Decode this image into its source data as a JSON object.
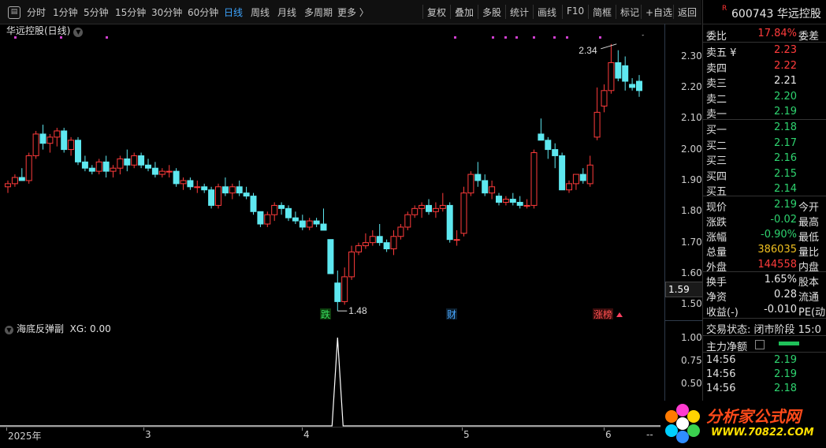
{
  "toolbar": {
    "periods": [
      "分时",
      "1分钟",
      "5分钟",
      "15分钟",
      "30分钟",
      "60分钟",
      "日线",
      "周线",
      "月线",
      "多周期",
      "更多 〉"
    ],
    "active_period": "日线",
    "actions": [
      "复权",
      "叠加",
      "多股",
      "统计",
      "画线",
      "F10",
      "简框",
      "标记",
      "+自选",
      "返回"
    ]
  },
  "chart": {
    "title": "华远控股(日线)",
    "y_ticks": [
      "2.30",
      "2.20",
      "2.10",
      "2.00",
      "1.90",
      "1.80",
      "1.70",
      "1.60",
      "1.50"
    ],
    "current_price_label": "1.59",
    "high_label": "2.34",
    "low_label": "1.48",
    "markers": [
      "跌",
      "财",
      "涨榜"
    ],
    "sub_title": "海底反弹副",
    "sub_indicator": "XG: 0.00",
    "sub_ticks": [
      "1.00",
      "0.75",
      "0.50",
      "0.25"
    ],
    "date_labels": [
      "2025年",
      "3",
      "4",
      "5",
      "6",
      "--"
    ]
  },
  "chart_data": [
    {
      "type": "candlestick",
      "title": "华远控股(日线)",
      "ylim": [
        1.45,
        2.37
      ],
      "up_color": "#ff3b3b",
      "down_color": "#5ee8f0",
      "candles": [
        [
          1.88,
          1.9,
          1.86,
          1.89
        ],
        [
          1.89,
          1.92,
          1.88,
          1.91
        ],
        [
          1.91,
          1.94,
          1.9,
          1.9
        ],
        [
          1.9,
          1.99,
          1.89,
          1.98
        ],
        [
          1.98,
          2.06,
          1.97,
          2.05
        ],
        [
          2.05,
          2.08,
          2.0,
          2.02
        ],
        [
          2.02,
          2.05,
          1.99,
          2.04
        ],
        [
          2.04,
          2.07,
          2.01,
          2.06
        ],
        [
          2.06,
          2.07,
          1.99,
          2.0
        ],
        [
          2.0,
          2.04,
          1.98,
          2.03
        ],
        [
          2.03,
          2.04,
          1.95,
          1.96
        ],
        [
          1.96,
          1.98,
          1.93,
          1.94
        ],
        [
          1.94,
          1.95,
          1.92,
          1.93
        ],
        [
          1.93,
          1.97,
          1.92,
          1.96
        ],
        [
          1.96,
          1.98,
          1.91,
          1.93
        ],
        [
          1.93,
          1.95,
          1.91,
          1.94
        ],
        [
          1.94,
          1.98,
          1.92,
          1.97
        ],
        [
          1.97,
          2.0,
          1.93,
          1.95
        ],
        [
          1.95,
          1.99,
          1.94,
          1.98
        ],
        [
          1.98,
          1.99,
          1.94,
          1.95
        ],
        [
          1.95,
          1.97,
          1.93,
          1.94
        ],
        [
          1.94,
          1.96,
          1.91,
          1.92
        ],
        [
          1.92,
          1.94,
          1.91,
          1.93
        ],
        [
          1.93,
          1.95,
          1.91,
          1.93
        ],
        [
          1.93,
          1.94,
          1.88,
          1.89
        ],
        [
          1.89,
          1.91,
          1.87,
          1.9
        ],
        [
          1.9,
          1.91,
          1.87,
          1.88
        ],
        [
          1.88,
          1.9,
          1.86,
          1.88
        ],
        [
          1.88,
          1.89,
          1.86,
          1.87
        ],
        [
          1.87,
          1.88,
          1.81,
          1.82
        ],
        [
          1.82,
          1.89,
          1.81,
          1.88
        ],
        [
          1.88,
          1.91,
          1.85,
          1.86
        ],
        [
          1.86,
          1.89,
          1.84,
          1.88
        ],
        [
          1.88,
          1.9,
          1.85,
          1.86
        ],
        [
          1.86,
          1.88,
          1.84,
          1.85
        ],
        [
          1.85,
          1.86,
          1.79,
          1.8
        ],
        [
          1.8,
          1.8,
          1.75,
          1.76
        ],
        [
          1.76,
          1.8,
          1.75,
          1.79
        ],
        [
          1.79,
          1.83,
          1.77,
          1.82
        ],
        [
          1.82,
          1.83,
          1.79,
          1.81
        ],
        [
          1.81,
          1.82,
          1.77,
          1.78
        ],
        [
          1.78,
          1.8,
          1.76,
          1.77
        ],
        [
          1.77,
          1.79,
          1.74,
          1.75
        ],
        [
          1.75,
          1.78,
          1.74,
          1.77
        ],
        [
          1.77,
          1.78,
          1.75,
          1.76
        ],
        [
          1.76,
          1.81,
          1.74,
          1.74
        ],
        [
          1.71,
          1.71,
          1.6,
          1.6
        ],
        [
          1.57,
          1.61,
          1.48,
          1.51
        ],
        [
          1.51,
          1.62,
          1.5,
          1.59
        ],
        [
          1.59,
          1.69,
          1.58,
          1.67
        ],
        [
          1.67,
          1.7,
          1.66,
          1.69
        ],
        [
          1.69,
          1.73,
          1.68,
          1.7
        ],
        [
          1.7,
          1.74,
          1.69,
          1.72
        ],
        [
          1.72,
          1.76,
          1.69,
          1.7
        ],
        [
          1.7,
          1.71,
          1.67,
          1.68
        ],
        [
          1.68,
          1.74,
          1.66,
          1.72
        ],
        [
          1.72,
          1.76,
          1.71,
          1.75
        ],
        [
          1.75,
          1.8,
          1.74,
          1.79
        ],
        [
          1.79,
          1.82,
          1.78,
          1.81
        ],
        [
          1.81,
          1.83,
          1.78,
          1.82
        ],
        [
          1.82,
          1.84,
          1.79,
          1.8
        ],
        [
          1.8,
          1.83,
          1.78,
          1.81
        ],
        [
          1.81,
          1.86,
          1.8,
          1.82
        ],
        [
          1.82,
          1.83,
          1.7,
          1.71
        ],
        [
          1.71,
          1.74,
          1.69,
          1.71
        ],
        [
          1.73,
          1.88,
          1.72,
          1.86
        ],
        [
          1.86,
          1.93,
          1.85,
          1.92
        ],
        [
          1.92,
          1.96,
          1.88,
          1.9
        ],
        [
          1.9,
          1.92,
          1.85,
          1.86
        ],
        [
          1.86,
          1.9,
          1.84,
          1.88
        ],
        [
          1.85,
          1.86,
          1.82,
          1.83
        ],
        [
          1.83,
          1.85,
          1.82,
          1.84
        ],
        [
          1.84,
          1.86,
          1.82,
          1.83
        ],
        [
          1.83,
          1.85,
          1.81,
          1.82
        ],
        [
          1.82,
          1.84,
          1.81,
          1.82
        ],
        [
          1.82,
          2.0,
          1.81,
          1.99
        ],
        [
          2.05,
          2.1,
          2.03,
          2.03
        ],
        [
          2.03,
          2.04,
          1.97,
          2.0
        ],
        [
          2.0,
          2.02,
          1.94,
          1.98
        ],
        [
          1.98,
          1.99,
          1.87,
          1.87
        ],
        [
          1.87,
          1.9,
          1.86,
          1.89
        ],
        [
          1.89,
          1.92,
          1.87,
          1.92
        ],
        [
          1.92,
          1.94,
          1.89,
          1.9
        ],
        [
          1.89,
          1.98,
          1.88,
          1.95
        ],
        [
          2.04,
          2.2,
          2.03,
          2.12
        ],
        [
          2.14,
          2.21,
          2.12,
          2.19
        ],
        [
          2.19,
          2.34,
          2.18,
          2.28
        ],
        [
          2.28,
          2.32,
          2.22,
          2.23
        ],
        [
          2.27,
          2.3,
          2.19,
          2.22
        ],
        [
          2.21,
          2.23,
          2.19,
          2.2
        ],
        [
          2.22,
          2.24,
          2.17,
          2.19
        ]
      ]
    },
    {
      "type": "line",
      "title": "海底反弹副",
      "ylim": [
        0,
        1
      ],
      "series": [
        {
          "name": "XG",
          "spike_index": 47,
          "values_note": "0 everywhere except 1.00 at spike_index"
        }
      ]
    }
  ],
  "side": {
    "stock_badge": "R",
    "stock_code": "600743 华远控股",
    "weibi_label": "委比",
    "weibi_value": "17.84%",
    "weicha_label": "委差",
    "asks": [
      {
        "label": "卖五 ¥",
        "price": "2.23"
      },
      {
        "label": "卖四",
        "price": "2.22"
      },
      {
        "label": "卖三",
        "price": "2.21"
      },
      {
        "label": "卖二",
        "price": "2.20"
      },
      {
        "label": "卖一",
        "price": "2.19"
      }
    ],
    "bids": [
      {
        "label": "买一",
        "price": "2.18"
      },
      {
        "label": "买二",
        "price": "2.17"
      },
      {
        "label": "买三",
        "price": "2.16"
      },
      {
        "label": "买四",
        "price": "2.15"
      },
      {
        "label": "买五",
        "price": "2.14"
      }
    ],
    "stats": [
      {
        "label": "现价",
        "value": "2.19",
        "right": "今开"
      },
      {
        "label": "涨跌",
        "value": "-0.02",
        "right": "最高"
      },
      {
        "label": "涨幅",
        "value": "-0.90%",
        "right": "最低"
      },
      {
        "label": "总量",
        "value": "386035",
        "right": "量比"
      },
      {
        "label": "外盘",
        "value": "144558",
        "right": "内盘"
      }
    ],
    "stats2": [
      {
        "label": "换手",
        "value": "1.65%",
        "right": "股本"
      },
      {
        "label": "净资",
        "value": "0.28",
        "right": "流通"
      },
      {
        "label": "收益(-)",
        "value": "-0.010",
        "right": "PE(动"
      }
    ],
    "trade_status": "交易状态: 闭市阶段 15:0",
    "main_flow_label": "主力净额",
    "ticks": [
      {
        "time": "14:56",
        "price": "2.19"
      },
      {
        "time": "14:56",
        "price": "2.19"
      },
      {
        "time": "14:56",
        "price": "2.18"
      }
    ]
  },
  "watermark": {
    "text": "分析家公式网",
    "url": "WWW.70822.COM"
  }
}
